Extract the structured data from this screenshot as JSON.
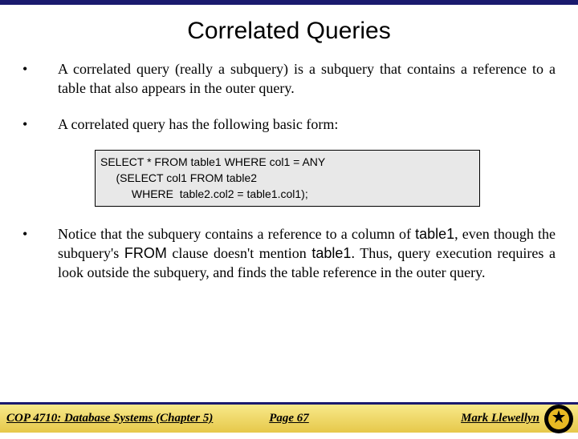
{
  "title": "Correlated Queries",
  "bullets": {
    "b1": "A correlated query (really a subquery) is a subquery that contains a reference to a table that also appears in the outer query.",
    "b2": "A correlated query has the following basic form:",
    "b3_pre": "Notice that the subquery contains a reference to a column of ",
    "b3_t1": "table1",
    "b3_mid1": ", even though the subquery's ",
    "b3_from": "FROM",
    "b3_mid2": " clause doesn't mention ",
    "b3_t1b": "table1",
    "b3_post": ". Thus, query execution requires a look outside the subquery, and finds the table reference in the outer query."
  },
  "code": "SELECT * FROM table1 WHERE col1 = ANY\n     (SELECT col1 FROM table2\n          WHERE  table2.col2 = table1.col1);",
  "footer": {
    "left": "COP 4710: Database Systems  (Chapter 5)",
    "center": "Page 67",
    "right": "Mark Llewellyn"
  }
}
